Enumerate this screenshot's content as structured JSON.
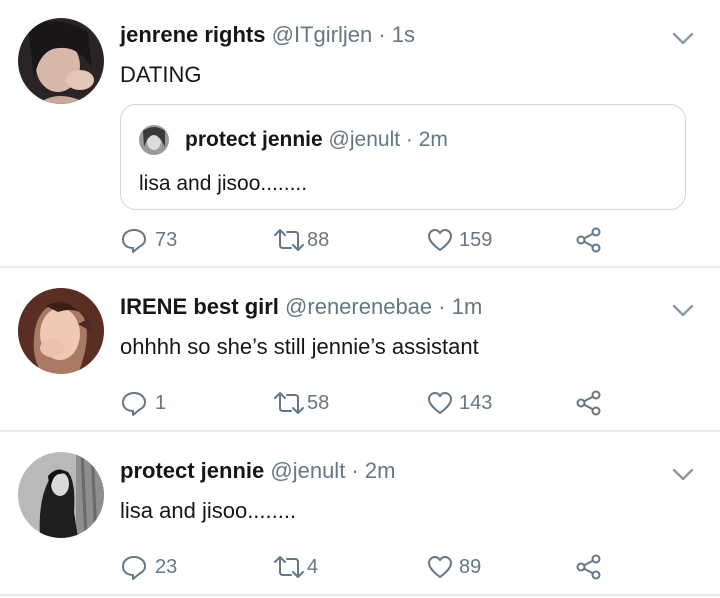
{
  "tweets": [
    {
      "name": "jenrene rights",
      "handle": "@ITgirljen",
      "time": "1s",
      "text": "DATING",
      "quote": {
        "name": "protect jennie",
        "handle": "@jenult",
        "time": "2m",
        "text": "lisa and jisoo........"
      },
      "replies": "73",
      "retweets": "88",
      "likes": "159"
    },
    {
      "name": "IRENE best girl",
      "handle": "@renerenebae",
      "time": "1m",
      "text": "ohhhh so she’s still jennie’s assistant",
      "replies": "1",
      "retweets": "58",
      "likes": "143"
    },
    {
      "name": "protect jennie",
      "handle": "@jenult",
      "time": "2m",
      "text": "lisa and jisoo........",
      "replies": "23",
      "retweets": "4",
      "likes": "89"
    }
  ],
  "separator": " · ",
  "colors": {
    "name_text": "#14171a",
    "secondary_text": "#657786",
    "divider": "#e6ecf0",
    "quote_border": "#ccd6dd"
  },
  "icons": [
    "reply-icon",
    "retweet-icon",
    "like-icon",
    "share-icon",
    "chevron-down-icon"
  ]
}
